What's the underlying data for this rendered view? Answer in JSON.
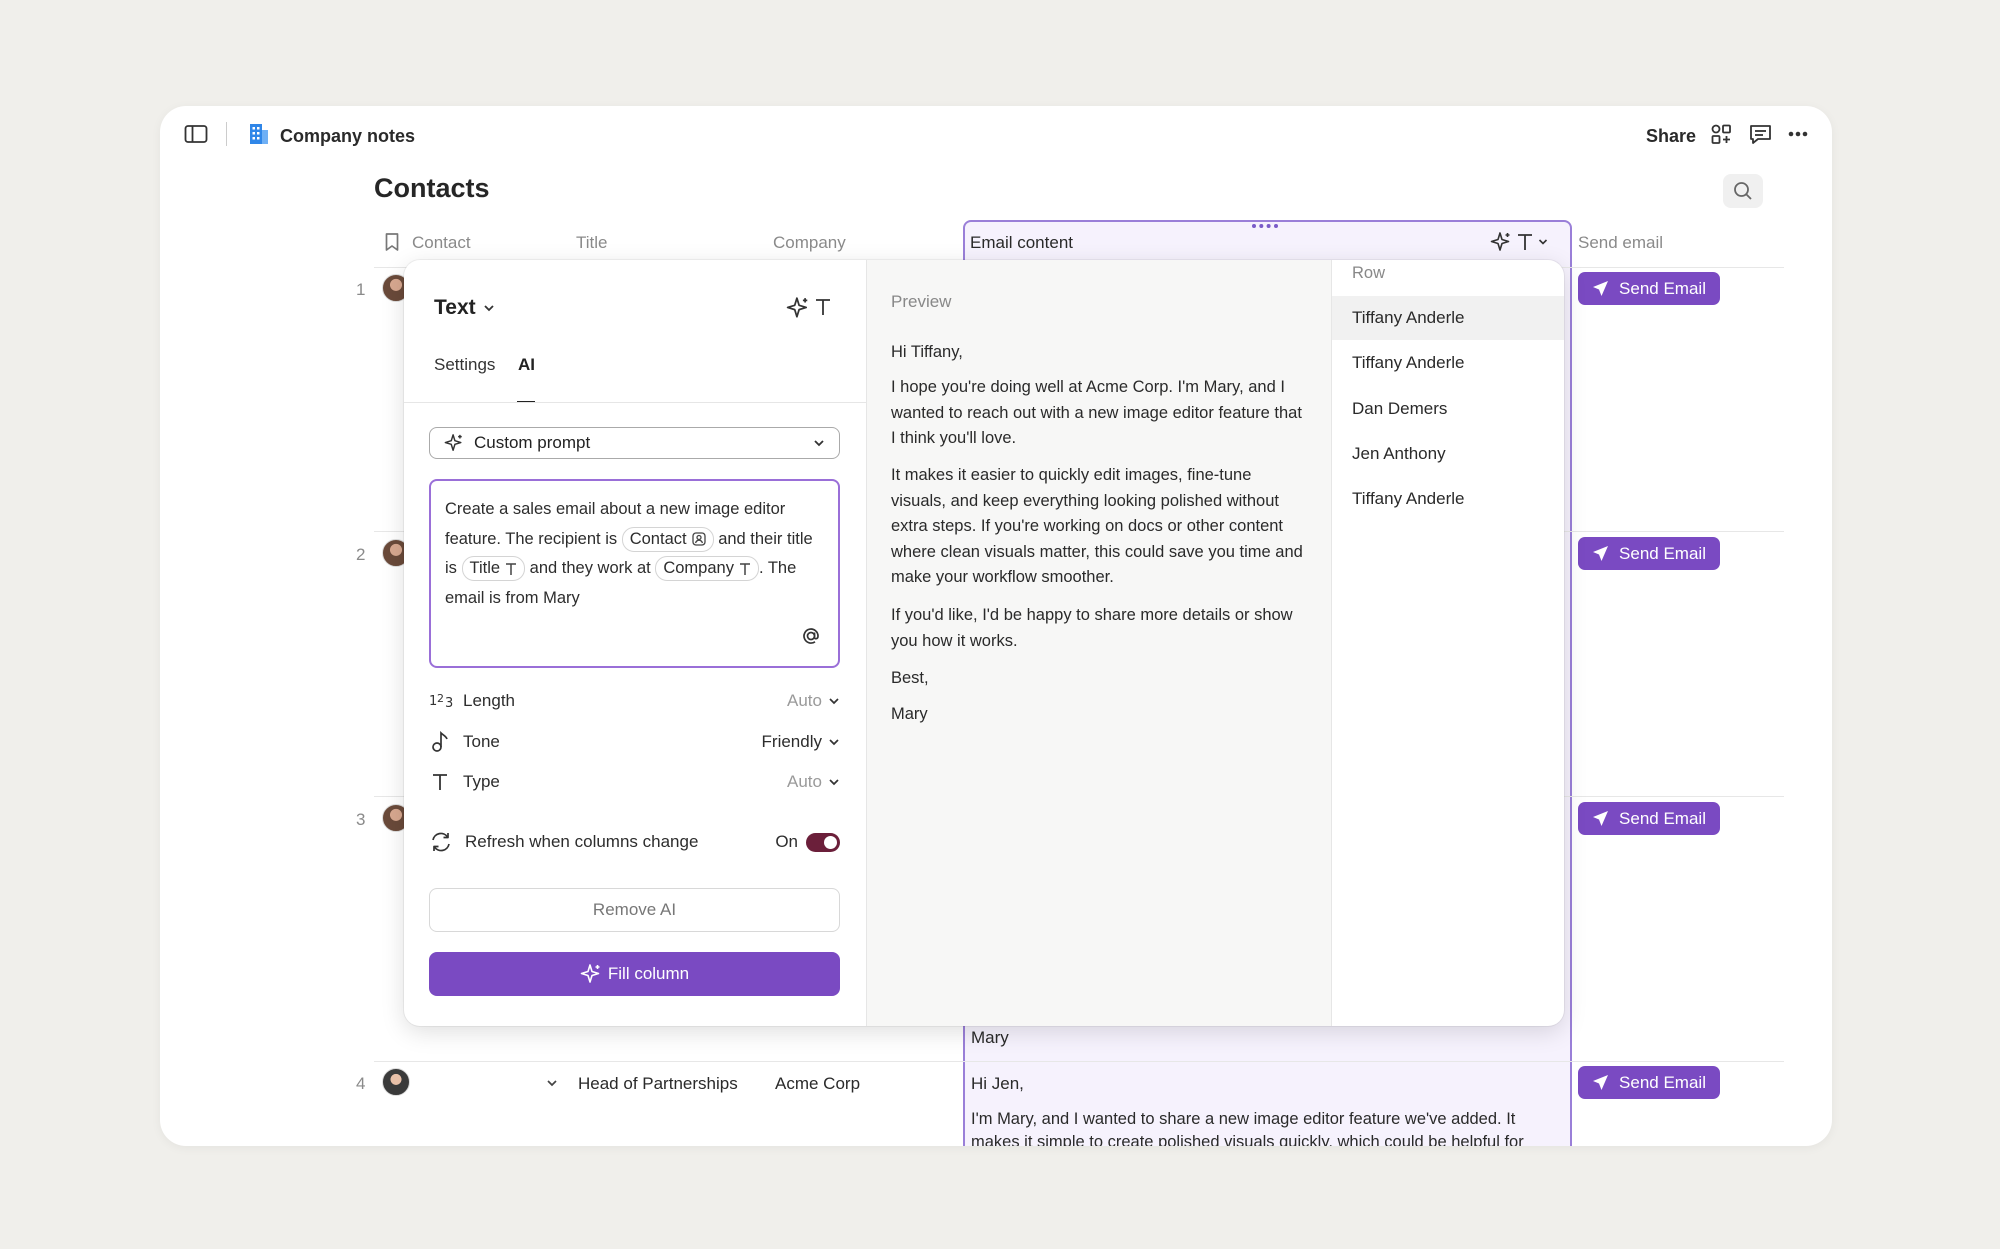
{
  "topbar": {
    "doc_title": "Company notes",
    "share_label": "Share"
  },
  "page": {
    "title": "Contacts"
  },
  "columns": {
    "contact": "Contact",
    "title": "Title",
    "company": "Company",
    "email_content": "Email content",
    "send_email": "Send email"
  },
  "rows": [
    {
      "num": "1",
      "send_label": "Send Email"
    },
    {
      "num": "2",
      "send_label": "Send Email"
    },
    {
      "num": "3",
      "send_label": "Send Email"
    },
    {
      "num": "4",
      "title": "Head of Partnerships",
      "company": "Acme Corp",
      "email_greeting": "Hi Jen,",
      "email_body": "I'm Mary, and I wanted to share a new image editor feature we've added. It makes it simple to create polished visuals quickly, which could be helpful for",
      "send_label": "Send Email"
    }
  ],
  "row3_email_tail": "Mary",
  "ai_panel": {
    "type_label": "Text",
    "tabs": {
      "settings": "Settings",
      "ai": "AI"
    },
    "prompt_select": "Custom prompt",
    "prompt": {
      "part1": "Create a sales email about a new image editor feature. The recipient is",
      "chip_contact": "Contact",
      "part2": "and their title is",
      "chip_title": "Title",
      "part3": "and they work at",
      "chip_company": "Company",
      "part4": ". The email is from Mary"
    },
    "length_label": "Length",
    "length_value": "Auto",
    "tone_label": "Tone",
    "tone_value": "Friendly",
    "type_setting_label": "Type",
    "type_value": "Auto",
    "refresh_label": "Refresh when columns change",
    "refresh_state": "On",
    "remove_label": "Remove AI",
    "fill_label": "Fill column"
  },
  "preview": {
    "heading": "Preview",
    "greeting": "Hi Tiffany,",
    "p1": "I hope you're doing well at Acme Corp. I'm Mary, and I wanted to reach out with a new image editor feature that I think you'll love.",
    "p2": "It makes it easier to quickly edit images, fine-tune visuals, and keep everything looking polished without extra steps. If you're working on docs or other content where clean visuals matter, this could save you time and make your workflow smoother.",
    "p3": "If you'd like, I'd be happy to share more details or show you how it works.",
    "signoff": "Best,",
    "name": "Mary"
  },
  "row_picker": {
    "heading": "Row",
    "items": [
      "Tiffany Anderle",
      "Tiffany Anderle",
      "Dan Demers",
      "Jen Anthony",
      "Tiffany Anderle"
    ]
  },
  "colors": {
    "accent": "#7a4ac2",
    "toggle": "#6b1f3a",
    "column_highlight": "#f6f2fd"
  }
}
